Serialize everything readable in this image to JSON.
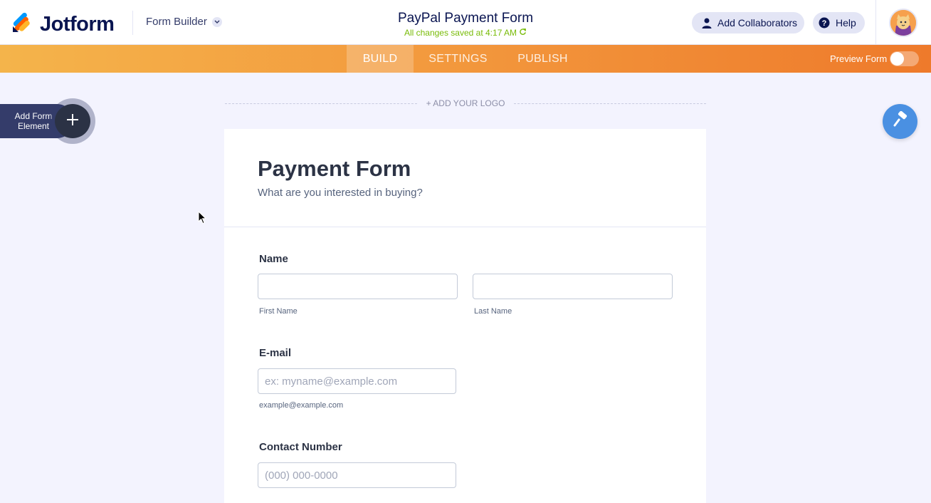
{
  "header": {
    "brand": "Jotform",
    "builder_switch": "Form Builder",
    "form_title": "PayPal Payment Form",
    "saved_status": "All changes saved at 4:17 AM",
    "collaborators_button": "Add Collaborators",
    "help_button": "Help"
  },
  "nav": {
    "tabs": [
      {
        "label": "BUILD",
        "active": true
      },
      {
        "label": "SETTINGS",
        "active": false
      },
      {
        "label": "PUBLISH",
        "active": false
      }
    ],
    "preview_label": "Preview Form",
    "preview_on": false
  },
  "sidebar": {
    "add_element_label": "Add Form Element"
  },
  "canvas": {
    "add_logo": "+ ADD YOUR LOGO"
  },
  "form": {
    "title": "Payment Form",
    "subtitle": "What are you interested in buying?",
    "name": {
      "label": "Name",
      "first_sublabel": "First Name",
      "last_sublabel": "Last Name",
      "first_value": "",
      "last_value": ""
    },
    "email": {
      "label": "E-mail",
      "placeholder": "ex: myname@example.com",
      "sublabel": "example@example.com"
    },
    "phone": {
      "label": "Contact Number",
      "placeholder": "(000) 000-0000"
    }
  },
  "colors": {
    "accent_orange": "#f39a3e",
    "saved_green": "#78bb07",
    "designer_blue": "#4a90e2",
    "brand_navy": "#0a1551"
  },
  "icons": {
    "brand": "jotform-logo-icon",
    "chevron": "chevron-down-icon",
    "refresh": "refresh-icon",
    "user": "user-icon",
    "help": "help-icon",
    "plus": "plus-icon",
    "designer": "paint-roller-icon",
    "cursor": "mouse-cursor-icon"
  }
}
